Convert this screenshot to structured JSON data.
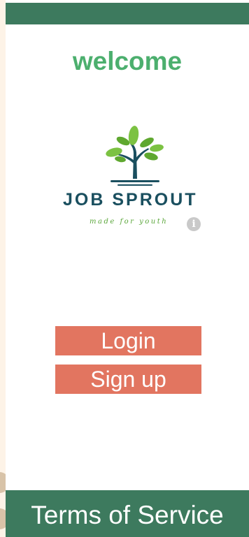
{
  "header": {
    "welcome": "welcome"
  },
  "logo": {
    "title": "JOB SPROUT",
    "tagline": "made for youth"
  },
  "actions": {
    "login_label": "Login",
    "signup_label": "Sign up"
  },
  "footer": {
    "terms_label": "Terms of Service"
  },
  "icons": {
    "info": "info-icon",
    "logo": "tree-logo-icon"
  },
  "colors": {
    "bar": "#3d7a5e",
    "welcome": "#4caf6e",
    "button": "#e27560",
    "logo_text": "#1a4f5f",
    "tagline": "#5aa63a",
    "side": "#fdf3e7"
  }
}
